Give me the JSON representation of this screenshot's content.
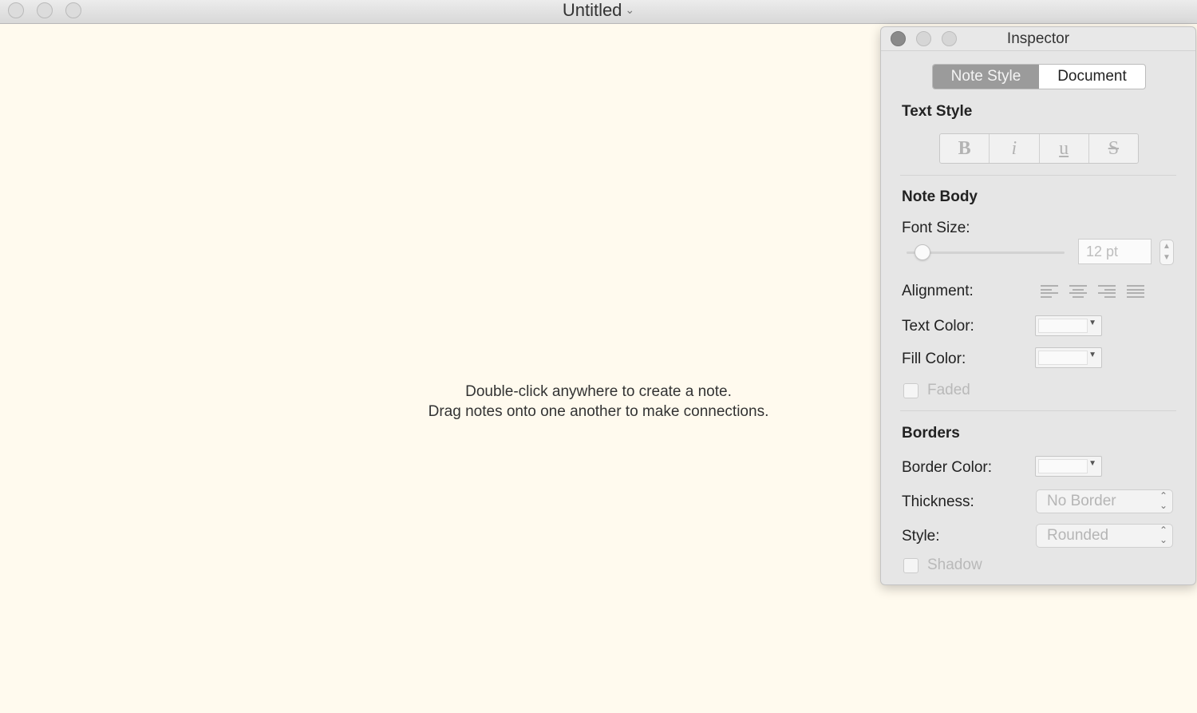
{
  "window": {
    "title": "Untitled",
    "title_chevron": "⌄"
  },
  "canvas": {
    "hint_line1": "Double-click anywhere to create a note.",
    "hint_line2": "Drag notes onto one another to make connections."
  },
  "inspector": {
    "title": "Inspector",
    "tabs": [
      {
        "label": "Note Style",
        "selected": true
      },
      {
        "label": "Document",
        "selected": false
      }
    ],
    "text_style": {
      "heading": "Text Style",
      "buttons": [
        "B",
        "i",
        "u",
        "S"
      ]
    },
    "note_body": {
      "heading": "Note Body",
      "font_size_label": "Font Size:",
      "font_size_value": "12 pt",
      "alignment_label": "Alignment:",
      "alignment_icons": [
        "align-left-icon",
        "align-center-icon",
        "align-right-icon",
        "align-justify-icon"
      ],
      "text_color_label": "Text Color:",
      "fill_color_label": "Fill Color:",
      "faded_label": "Faded",
      "faded_checked": false
    },
    "borders": {
      "heading": "Borders",
      "border_color_label": "Border Color:",
      "thickness_label": "Thickness:",
      "thickness_value": "No Border",
      "style_label": "Style:",
      "style_value": "Rounded",
      "shadow_label": "Shadow",
      "shadow_checked": false
    }
  }
}
